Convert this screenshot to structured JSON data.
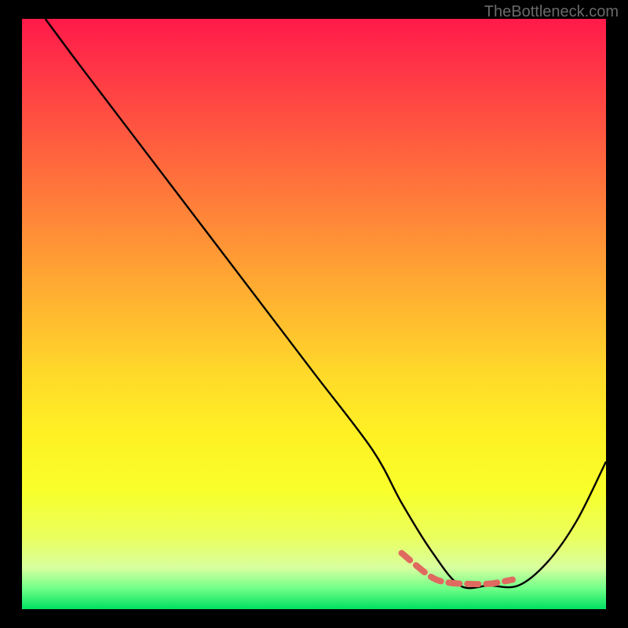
{
  "watermark": "TheBottleneck.com",
  "chart_data": {
    "type": "line",
    "title": "",
    "xlabel": "",
    "ylabel": "",
    "xlim": [
      0,
      100
    ],
    "ylim": [
      0,
      100
    ],
    "series": [
      {
        "name": "bottleneck-curve",
        "x": [
          4,
          10,
          20,
          30,
          40,
          50,
          60,
          65,
          70,
          75,
          80,
          85,
          90,
          95,
          100
        ],
        "y": [
          100,
          92,
          79,
          66,
          53,
          40,
          27,
          18,
          10,
          4,
          4,
          4,
          8,
          15,
          25
        ]
      }
    ],
    "highlight": {
      "name": "optimal-range",
      "x": [
        65,
        70,
        73,
        76,
        80,
        84
      ],
      "y": [
        9.5,
        5.5,
        4.5,
        4.3,
        4.3,
        5.0
      ]
    },
    "gradient_stops": [
      {
        "pct": 0,
        "color": "#ff1a4a"
      },
      {
        "pct": 50,
        "color": "#ffba2f"
      },
      {
        "pct": 80,
        "color": "#f8ff2a"
      },
      {
        "pct": 100,
        "color": "#00e060"
      }
    ]
  }
}
